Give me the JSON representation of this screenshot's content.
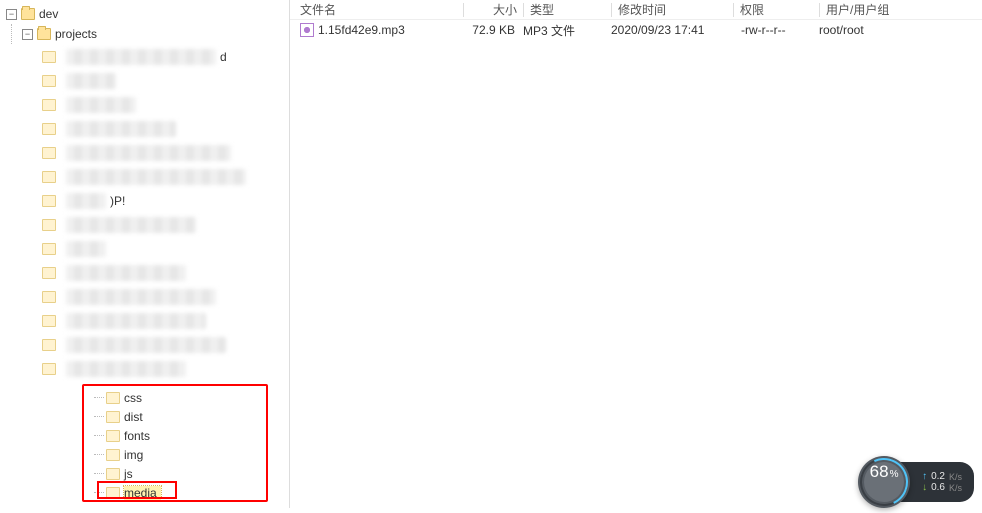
{
  "tree": {
    "root_label": "dev",
    "projects_label": "projects",
    "blur_tail_letter": "d",
    "blur_mid_text": ")P!",
    "subfolders": [
      "css",
      "dist",
      "fonts",
      "img",
      "js",
      "media"
    ]
  },
  "columns": {
    "name": "文件名",
    "size": "大小",
    "type": "类型",
    "modified": "修改时间",
    "perm": "权限",
    "owner": "用户/用户组"
  },
  "files": [
    {
      "name": "1.15fd42e9.mp3",
      "size": "72.9 KB",
      "type": "MP3 文件",
      "modified": "2020/09/23 17:41",
      "perm": "-rw-r--r--",
      "owner": "root/root"
    }
  ],
  "widget": {
    "percent": "68",
    "percent_suffix": "%",
    "up_value": "0.2",
    "up_unit": "K/s",
    "down_value": "0.6",
    "down_unit": "K/s"
  }
}
